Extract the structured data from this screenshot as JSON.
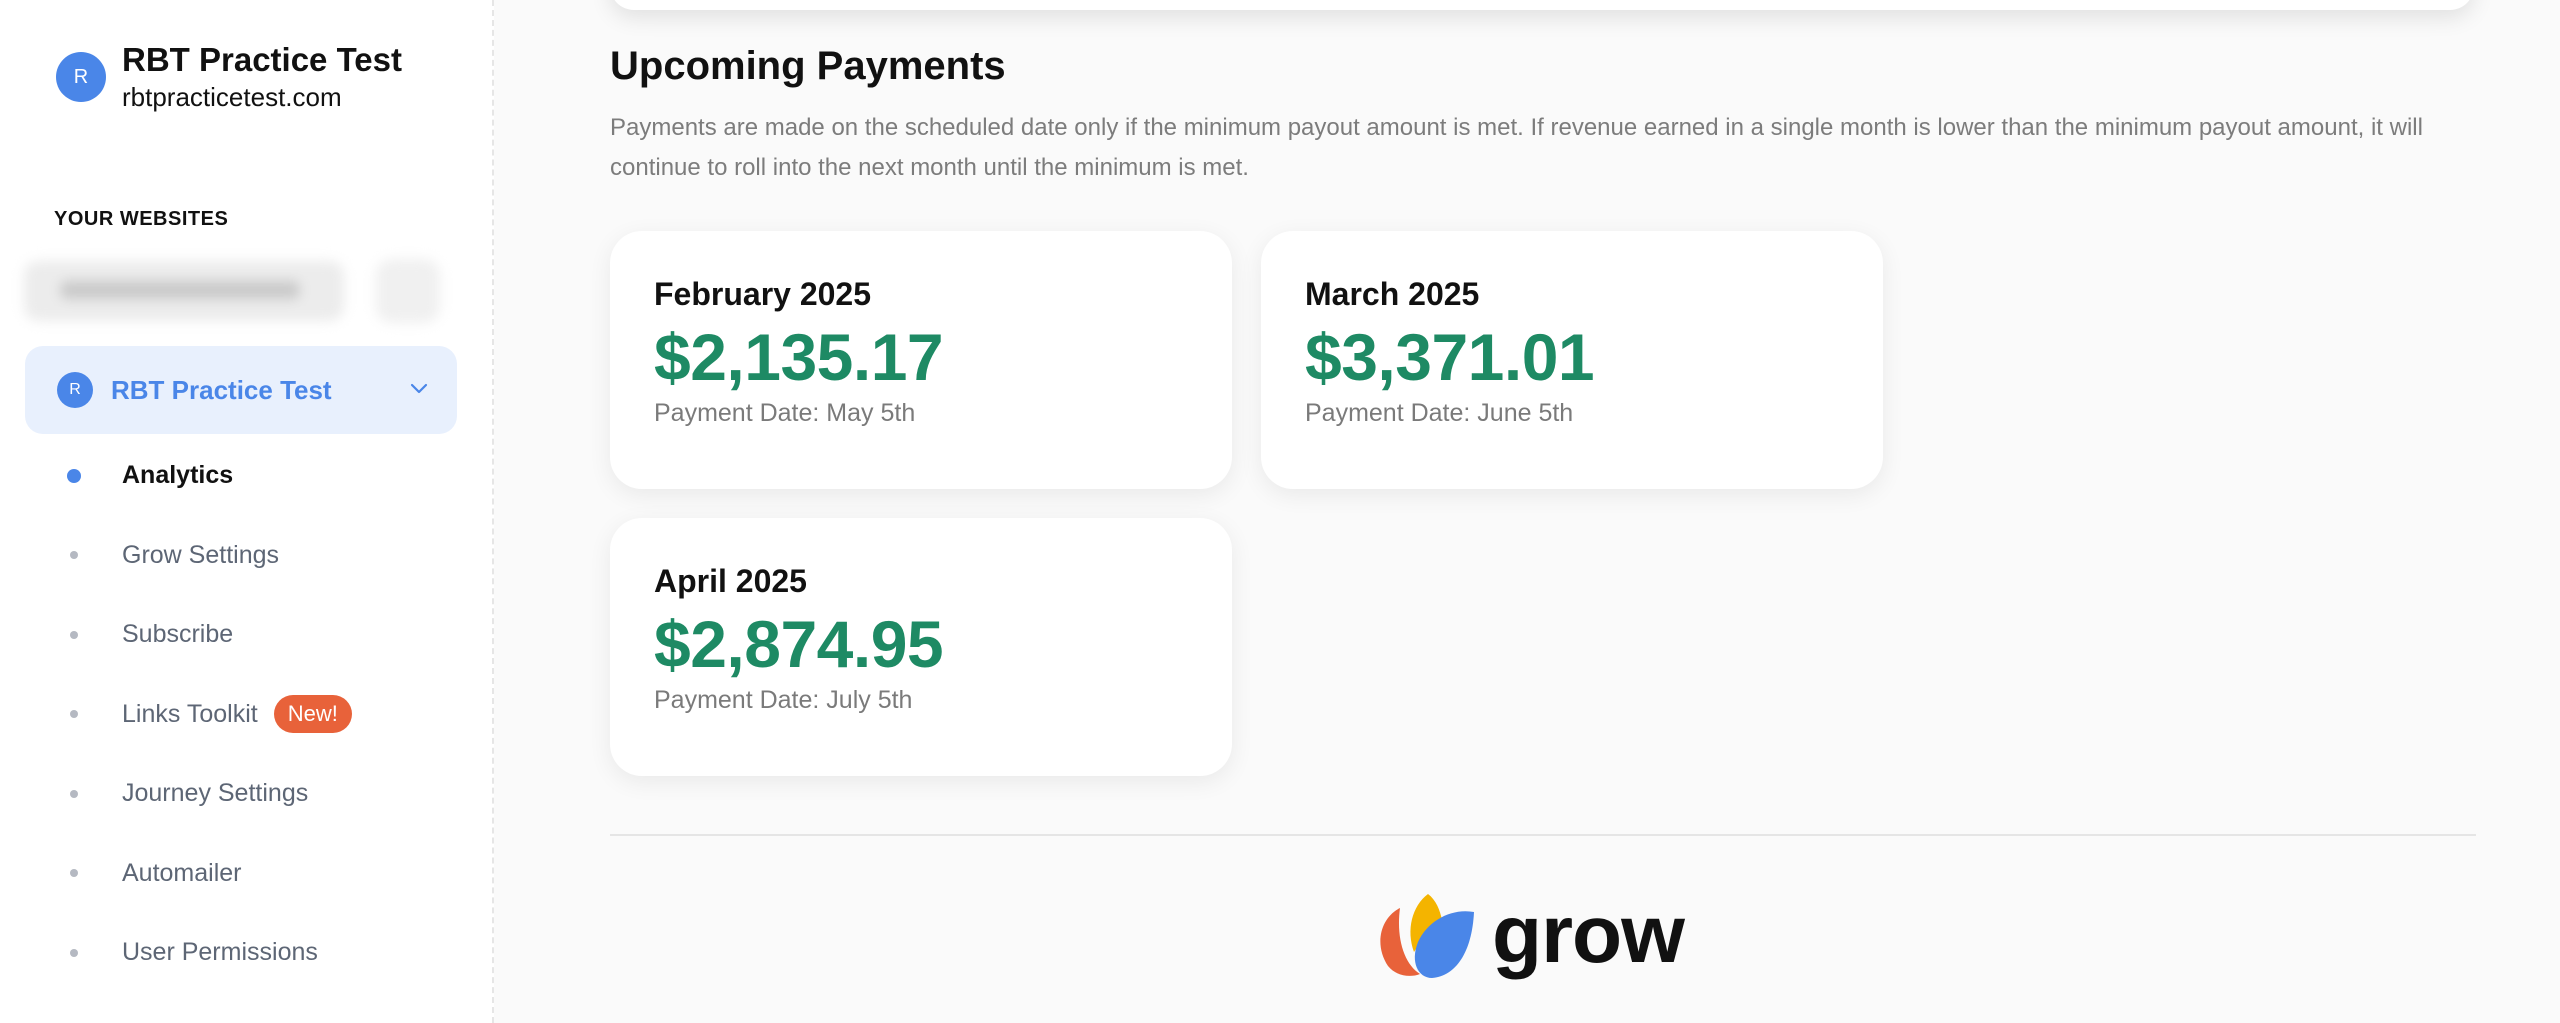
{
  "site": {
    "avatar_letter": "R",
    "name": "RBT Practice Test",
    "url": "rbtpracticetest.com"
  },
  "sidebar": {
    "section_label": "YOUR WEBSITES",
    "selected_site": {
      "avatar_letter": "R",
      "label": "RBT Practice Test"
    },
    "items": [
      {
        "label": "Analytics",
        "active": true
      },
      {
        "label": "Grow Settings"
      },
      {
        "label": "Subscribe"
      },
      {
        "label": "Links Toolkit",
        "badge": "New!"
      },
      {
        "label": "Journey Settings"
      },
      {
        "label": "Automailer"
      },
      {
        "label": "User Permissions"
      }
    ]
  },
  "main": {
    "title": "Upcoming Payments",
    "description": "Payments are made on the scheduled date only if the minimum payout amount is met. If revenue earned in a single month is lower than the minimum payout amount, it will continue to roll into the next month until the minimum is met.",
    "payments": [
      {
        "month": "February 2025",
        "amount": "$2,135.17",
        "payment_date": "Payment Date: May 5th"
      },
      {
        "month": "March 2025",
        "amount": "$3,371.01",
        "payment_date": "Payment Date: June 5th"
      },
      {
        "month": "April 2025",
        "amount": "$2,874.95",
        "payment_date": "Payment Date: July 5th"
      }
    ]
  },
  "footer": {
    "logo_text": "grow"
  },
  "colors": {
    "accent": "#4a86e8",
    "amount_green": "#1e8a64",
    "badge_orange": "#e8623a",
    "selected_bg": "#e8f0fd"
  }
}
